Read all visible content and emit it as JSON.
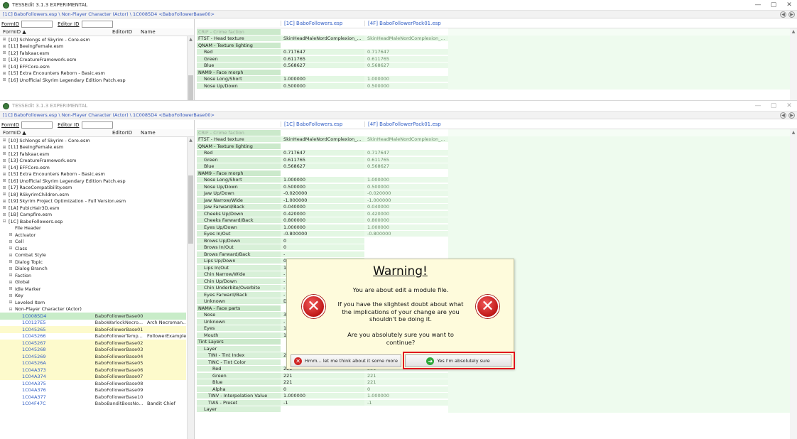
{
  "app_title": "TESSEdit 3.1.3 EXPERIMENTAL",
  "path": "[1C] BaboFollowers.esp \\ Non-Player Character (Actor) \\ 1C0085D4 <BaboFollowerBase00>",
  "window_controls": {
    "minimize": "—",
    "maximize": "▢",
    "close": "✕"
  },
  "nav": {
    "back": "◀",
    "forward": "▶"
  },
  "filter": {
    "formid_label": "FormID",
    "editorid_label": "Editor ID"
  },
  "tree_columns": [
    "FormID",
    "EditorID",
    "Name"
  ],
  "sort_indicator": "▲",
  "expand_symbol": "⊞",
  "collapse_symbol": "⊟",
  "scroll_up": "▲",
  "scroll_down": "▼",
  "plugins_w1": [
    "[10] Schlongs of Skyrim - Core.esm",
    "[11] BeeingFemale.esm",
    "[12] Falskaar.esm",
    "[13] CreatureFramework.esm",
    "[14] EFFCore.esm",
    "[15] Extra Encounters Reborn - Basic.esm",
    "[16] Unofficial Skyrim Legendary Edition Patch.esp"
  ],
  "plugins_w2": [
    "[10] Schlongs of Skyrim - Core.esm",
    "[11] BeeingFemale.esm",
    "[12] Falskaar.esm",
    "[13] CreatureFramework.esm",
    "[14] EFFCore.esm",
    "[15] Extra Encounters Reborn - Basic.esm",
    "[16] Unofficial Skyrim Legendary Edition Patch.esp",
    "[17] RaceCompatibility.esm",
    "[18] RSkyrimChildren.esm",
    "[19] Skyrim Project Optimization - Full Version.esm",
    "[1A] PubicHair3D.esm",
    "[1B] Campfire.esm",
    "[1C] BaboFollowers.esp"
  ],
  "groups": [
    "File Header",
    "Activator",
    "Cell",
    "Class",
    "Combat Style",
    "Dialog Topic",
    "Dialog Branch",
    "Faction",
    "Global",
    "Idle Marker",
    "Key",
    "Leveled Item",
    "Non-Player Character (Actor)"
  ],
  "npcs": [
    {
      "formid": "1C0085D4",
      "editorid": "BaboFollowerBase00",
      "name": ""
    },
    {
      "formid": "1C0127E5",
      "editorid": "BaboWarlockNecro...",
      "name": "Arch Necroman..."
    },
    {
      "formid": "1C045265",
      "editorid": "BaboFollowerBase01",
      "name": ""
    },
    {
      "formid": "1C045266",
      "editorid": "BaboFollowerTemp...",
      "name": "FollowerExample"
    },
    {
      "formid": "1C045267",
      "editorid": "BaboFollowerBase02",
      "name": ""
    },
    {
      "formid": "1C045268",
      "editorid": "BaboFollowerBase03",
      "name": ""
    },
    {
      "formid": "1C045269",
      "editorid": "BaboFollowerBase04",
      "name": ""
    },
    {
      "formid": "1C04526A",
      "editorid": "BaboFollowerBase05",
      "name": ""
    },
    {
      "formid": "1C04A373",
      "editorid": "BaboFollowerBase06",
      "name": ""
    },
    {
      "formid": "1C04A374",
      "editorid": "BaboFollowerBase07",
      "name": ""
    },
    {
      "formid": "1C04A375",
      "editorid": "BaboFollowerBase08",
      "name": ""
    },
    {
      "formid": "1C04A376",
      "editorid": "BaboFollowerBase09",
      "name": ""
    },
    {
      "formid": "1C04A377",
      "editorid": "BaboFollowerBase10",
      "name": ""
    },
    {
      "formid": "1C04F47C",
      "editorid": "BaboBanditBossNo...",
      "name": "Bandit Chief"
    }
  ],
  "right_columns": [
    "[1C] BaboFollowers.esp",
    "[4F] BaboFollowerPack01.esp"
  ],
  "records_w1": [
    {
      "label": "CRIF - Crime faction",
      "v1": "",
      "v2": "",
      "indent": 0,
      "style": "g2"
    },
    {
      "label": "FTST - Head texture",
      "v1": "SkinHeadMaleNordComplexion_...",
      "v2": "SkinHeadMaleNordComplexion_...",
      "indent": 0,
      "style": "g1"
    },
    {
      "label": "QNAM - Texture lighting",
      "v1": "",
      "v2": "",
      "indent": 0,
      "style": "g1"
    },
    {
      "label": "Red",
      "v1": "0.717647",
      "v2": "0.717647",
      "indent": 1,
      "style": "g1"
    },
    {
      "label": "Green",
      "v1": "0.611765",
      "v2": "0.611765",
      "indent": 1,
      "style": "g1"
    },
    {
      "label": "Blue",
      "v1": "0.568627",
      "v2": "0.568627",
      "indent": 1,
      "style": "g1"
    },
    {
      "label": "NAM9 - Face morph",
      "v1": "",
      "v2": "",
      "indent": 0,
      "style": "g1"
    },
    {
      "label": "Nose Long/Short",
      "v1": "1.000000",
      "v2": "1.000000",
      "indent": 1,
      "style": "g1"
    },
    {
      "label": "Nose Up/Down",
      "v1": "0.500000",
      "v2": "0.500000",
      "indent": 1,
      "style": "g1"
    }
  ],
  "records_w2": [
    {
      "label": "CRIF - Crime faction",
      "v1": "",
      "v2": "",
      "indent": 0,
      "style": "g2"
    },
    {
      "label": "FTST - Head texture",
      "v1": "SkinHeadMaleNordComplexion_...",
      "v2": "SkinHeadMaleNordComplexion_...",
      "indent": 0,
      "style": "g1"
    },
    {
      "label": "QNAM - Texture lighting",
      "v1": "",
      "v2": "",
      "indent": 0,
      "style": "g1"
    },
    {
      "label": "Red",
      "v1": "0.717647",
      "v2": "0.717647",
      "indent": 1,
      "style": "g1"
    },
    {
      "label": "Green",
      "v1": "0.611765",
      "v2": "0.611765",
      "indent": 1,
      "style": "g1"
    },
    {
      "label": "Blue",
      "v1": "0.568627",
      "v2": "0.568627",
      "indent": 1,
      "style": "g1"
    },
    {
      "label": "NAM9 - Face morph",
      "v1": "",
      "v2": "",
      "indent": 0,
      "style": "g1"
    },
    {
      "label": "Nose Long/Short",
      "v1": "1.000000",
      "v2": "1.000000",
      "indent": 1,
      "style": "g1"
    },
    {
      "label": "Nose Up/Down",
      "v1": "0.500000",
      "v2": "0.500000",
      "indent": 1,
      "style": "g1"
    },
    {
      "label": "Jaw Up/Down",
      "v1": "-0.020000",
      "v2": "-0.020000",
      "indent": 1,
      "style": "g1"
    },
    {
      "label": "Jaw Narrow/Wide",
      "v1": "-1.000000",
      "v2": "-1.000000",
      "indent": 1,
      "style": "g1"
    },
    {
      "label": "Jaw Farward/Back",
      "v1": "0.040000",
      "v2": "0.040000",
      "indent": 1,
      "style": "g1"
    },
    {
      "label": "Cheeks Up/Down",
      "v1": "0.420000",
      "v2": "0.420000",
      "indent": 1,
      "style": "g1"
    },
    {
      "label": "Cheeks Farward/Back",
      "v1": "0.800000",
      "v2": "0.800000",
      "indent": 1,
      "style": "g1"
    },
    {
      "label": "Eyes Up/Down",
      "v1": "1.000000",
      "v2": "1.000000",
      "indent": 1,
      "style": "g1"
    },
    {
      "label": "Eyes In/Out",
      "v1": "-0.800000",
      "v2": "-0.800000",
      "indent": 1,
      "style": "g1"
    },
    {
      "label": "Brows Up/Down",
      "v1": "0",
      "v2": "",
      "indent": 1,
      "style": "g1"
    },
    {
      "label": "Brows In/Out",
      "v1": "0",
      "v2": "",
      "indent": 1,
      "style": "g1"
    },
    {
      "label": "Brows Farward/Back",
      "v1": "-",
      "v2": "",
      "indent": 1,
      "style": "g1"
    },
    {
      "label": "Lips Up/Down",
      "v1": "0",
      "v2": "",
      "indent": 1,
      "style": "g1"
    },
    {
      "label": "Lips In/Out",
      "v1": "1",
      "v2": "",
      "indent": 1,
      "style": "g1"
    },
    {
      "label": "Chin Narrow/Wide",
      "v1": "-",
      "v2": "",
      "indent": 1,
      "style": "g1"
    },
    {
      "label": "Chin Up/Down",
      "v1": "-",
      "v2": "",
      "indent": 1,
      "style": "g1"
    },
    {
      "label": "Chin Underbite/Overbite",
      "v1": "-",
      "v2": "",
      "indent": 1,
      "style": "g1"
    },
    {
      "label": "Eyes Farward/Back",
      "v1": "-",
      "v2": "",
      "indent": 1,
      "style": "g1"
    },
    {
      "label": "Unknown",
      "v1": "D",
      "v2": "",
      "indent": 1,
      "style": "g1"
    },
    {
      "label": "NAMA - Face parts",
      "v1": "",
      "v2": "",
      "indent": 0,
      "style": "g1"
    },
    {
      "label": "Nose",
      "v1": "3",
      "v2": "",
      "indent": 1,
      "style": "g1"
    },
    {
      "label": "Unknown",
      "v1": "-",
      "v2": "",
      "indent": 1,
      "style": "g1"
    },
    {
      "label": "Eyes",
      "v1": "1",
      "v2": "",
      "indent": 1,
      "style": "g1"
    },
    {
      "label": "Mouth",
      "v1": "1",
      "v2": "",
      "indent": 1,
      "style": "g1"
    },
    {
      "label": "Tint Layers",
      "v1": "",
      "v2": "",
      "indent": 0,
      "style": "g1"
    },
    {
      "label": "Layer",
      "v1": "",
      "v2": "",
      "indent": 1,
      "style": "g1"
    },
    {
      "label": "TINI - Tint Index",
      "v1": "24",
      "v2": "24",
      "indent": 2,
      "style": "g1"
    },
    {
      "label": "TINC - Tint Color",
      "v1": "",
      "v2": "",
      "indent": 2,
      "style": "g1"
    },
    {
      "label": "Red",
      "v1": "221",
      "v2": "221",
      "indent": 3,
      "style": "g1"
    },
    {
      "label": "Green",
      "v1": "221",
      "v2": "221",
      "indent": 3,
      "style": "g1"
    },
    {
      "label": "Blue",
      "v1": "221",
      "v2": "221",
      "indent": 3,
      "style": "g1"
    },
    {
      "label": "Alpha",
      "v1": "0",
      "v2": "0",
      "indent": 3,
      "style": "g1"
    },
    {
      "label": "TINV - Interpolation Value",
      "v1": "1.000000",
      "v2": "1.000000",
      "indent": 2,
      "style": "g1"
    },
    {
      "label": "TIAS - Preset",
      "v1": "-1",
      "v2": "-1",
      "indent": 2,
      "style": "g1"
    },
    {
      "label": "Layer",
      "v1": "",
      "v2": "",
      "indent": 1,
      "style": "g1"
    }
  ],
  "dialog": {
    "title": "Warning!",
    "line1": "You are about edit a module file.",
    "line2": "If you have the slightest doubt about what the implications of your change are you shouldn't be doing it.",
    "line3": "Are you absolutely sure you want to continue?",
    "icon": "✕",
    "btn_no_icon": "✕",
    "btn_yes_icon": "➜",
    "btn_no": "Hmm... let me think about it some more",
    "btn_yes": "Yes I'm absolutely sure"
  }
}
